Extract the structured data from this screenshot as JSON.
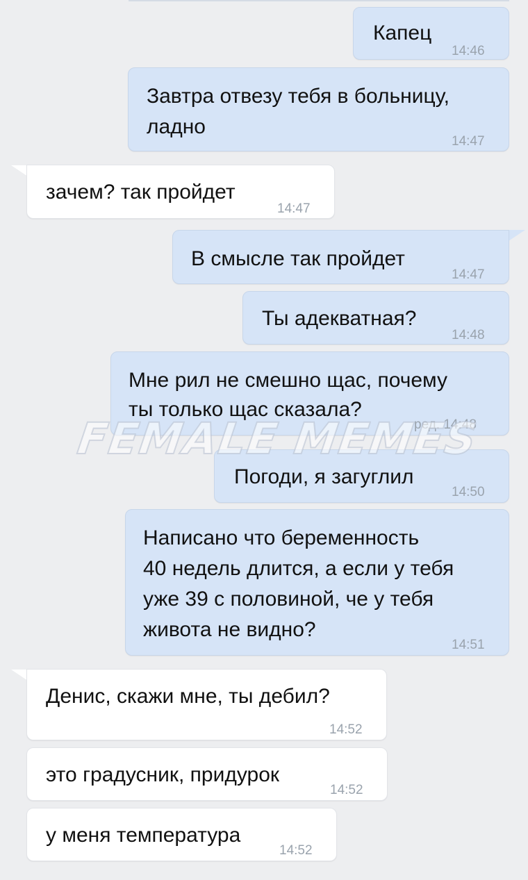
{
  "messages": [
    {
      "id": "m1",
      "dir": "out",
      "lines": [
        "Капец"
      ],
      "time": "14:46"
    },
    {
      "id": "m2",
      "dir": "out",
      "lines": [
        "Завтра отвезу тебя в больницу,",
        "ладно"
      ],
      "time": "14:47"
    },
    {
      "id": "m3",
      "dir": "in",
      "lines": [
        "зачем? так пройдет"
      ],
      "time": "14:47"
    },
    {
      "id": "m4",
      "dir": "out",
      "lines": [
        "В смысле так пройдет"
      ],
      "time": "14:47"
    },
    {
      "id": "m5",
      "dir": "out",
      "lines": [
        "Ты адекватная?"
      ],
      "time": "14:48"
    },
    {
      "id": "m6",
      "dir": "out",
      "lines": [
        "Мне рил не смешно щас, почему",
        "ты только щас сказала?"
      ],
      "time": "ред. 14:48"
    },
    {
      "id": "m7",
      "dir": "out",
      "lines": [
        "Погоди, я загуглил"
      ],
      "time": "14:50"
    },
    {
      "id": "m8",
      "dir": "out",
      "lines": [
        "Написано что беременность",
        "40 недель длится, а если у тебя",
        "уже 39 с половиной, че у тебя",
        "живота не видно?"
      ],
      "time": "14:51"
    },
    {
      "id": "m9",
      "dir": "in",
      "lines": [
        "Денис, скажи мне, ты дебил?"
      ],
      "time": "14:52"
    },
    {
      "id": "m10",
      "dir": "in",
      "lines": [
        "это градусник, придурок"
      ],
      "time": "14:52"
    },
    {
      "id": "m11",
      "dir": "in",
      "lines": [
        "у меня температура"
      ],
      "time": "14:52"
    }
  ],
  "watermark": "FEMALE MEMES",
  "colors": {
    "background": "#edeef0",
    "outgoing": "#d6e4f7",
    "incoming": "#ffffff",
    "time": "#9aa3ad"
  }
}
